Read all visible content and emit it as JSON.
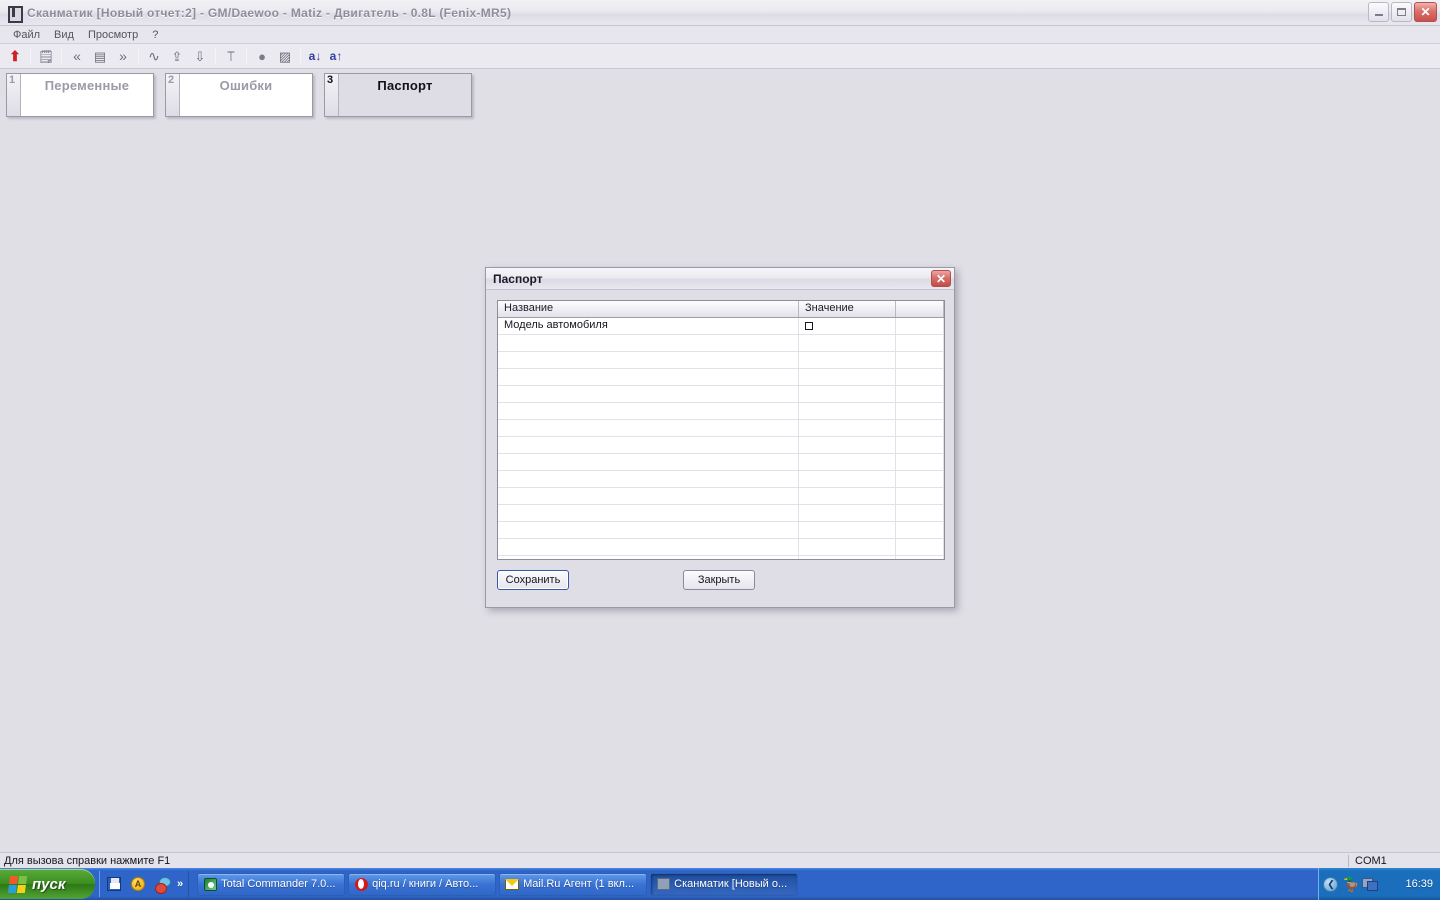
{
  "window": {
    "title": "Сканматик [Новый отчет:2] - GM/Daewoo - Matiz - Двигатель - 0.8L (Fenix-MR5)",
    "app_icon": "scanner-icon",
    "controls": {
      "minimize": "minimize-icon",
      "maximize": "restore-icon",
      "close": "✕"
    }
  },
  "menubar": {
    "items": [
      {
        "label": "Файл"
      },
      {
        "label": "Вид"
      },
      {
        "label": "Просмотр"
      },
      {
        "label": "?"
      }
    ]
  },
  "toolbar": {
    "buttons": [
      {
        "name": "upload-arrow-icon",
        "glyph": "⬆",
        "accent": "#cc2222"
      },
      {
        "name": "edit-report-icon",
        "glyph": "🗒"
      },
      {
        "name": "prev-page-icon",
        "glyph": "«"
      },
      {
        "name": "list-view-icon",
        "glyph": "▤"
      },
      {
        "name": "next-page-icon",
        "glyph": "»"
      },
      {
        "name": "waveform-icon",
        "glyph": "∿"
      },
      {
        "name": "add-channel-icon",
        "glyph": "⇪"
      },
      {
        "name": "remove-channel-icon",
        "glyph": "⇩"
      },
      {
        "name": "trigger-icon",
        "glyph": "⟙"
      },
      {
        "name": "record-icon",
        "glyph": "●"
      },
      {
        "name": "snapshot-icon",
        "glyph": "▨"
      },
      {
        "name": "font-decrease-icon",
        "glyph": "a↓"
      },
      {
        "name": "font-increase-icon",
        "glyph": "a↑"
      }
    ]
  },
  "tabs": [
    {
      "num": "1",
      "label": "Переменные",
      "active": false
    },
    {
      "num": "2",
      "label": "Ошибки",
      "active": false
    },
    {
      "num": "3",
      "label": "Паспорт",
      "active": true
    }
  ],
  "dialog": {
    "title": "Паспорт",
    "close_glyph": "✕",
    "grid": {
      "columns": [
        "Название",
        "Значение",
        ""
      ],
      "rows": [
        {
          "name": "Модель автомобиля",
          "value_glyph": "box",
          "extra": ""
        },
        {
          "name": "",
          "value_glyph": "",
          "extra": ""
        },
        {
          "name": "",
          "value_glyph": "",
          "extra": ""
        },
        {
          "name": "",
          "value_glyph": "",
          "extra": ""
        },
        {
          "name": "",
          "value_glyph": "",
          "extra": ""
        },
        {
          "name": "",
          "value_glyph": "",
          "extra": ""
        },
        {
          "name": "",
          "value_glyph": "",
          "extra": ""
        },
        {
          "name": "",
          "value_glyph": "",
          "extra": ""
        },
        {
          "name": "",
          "value_glyph": "",
          "extra": ""
        },
        {
          "name": "",
          "value_glyph": "",
          "extra": ""
        },
        {
          "name": "",
          "value_glyph": "",
          "extra": ""
        },
        {
          "name": "",
          "value_glyph": "",
          "extra": ""
        },
        {
          "name": "",
          "value_glyph": "",
          "extra": ""
        },
        {
          "name": "",
          "value_glyph": "",
          "extra": ""
        },
        {
          "name": "",
          "value_glyph": "",
          "extra": ""
        }
      ]
    },
    "save_label": "Сохранить",
    "close_label": "Закрыть"
  },
  "statusbar": {
    "hint": "Для вызова справки нажмите F1",
    "port": "COM1"
  },
  "taskbar": {
    "start_label": "пуск",
    "quicklaunch": [
      {
        "name": "floppy-save-icon"
      },
      {
        "name": "acrobat-icon",
        "glyph": "A"
      },
      {
        "name": "mixer-icon"
      }
    ],
    "quicklaunch_more": "»",
    "tasks": [
      {
        "label": "Total Commander 7.0...",
        "icon": "total-commander-icon",
        "active": false
      },
      {
        "label": "qiq.ru / книги / Авто...",
        "icon": "opera-icon",
        "active": false
      },
      {
        "label": "Mail.Ru Агент (1 вкл...",
        "icon": "mail-envelope-icon",
        "active": false
      },
      {
        "label": "Сканматик [Новый о...",
        "icon": "scanmatik-icon",
        "active": true
      }
    ],
    "tray": {
      "collapse_glyph": "❮",
      "icons": [
        {
          "name": "duck-icon",
          "glyph": "🦆"
        },
        {
          "name": "network-icon"
        },
        {
          "name": "pencil-icon"
        }
      ],
      "time": "16:39"
    }
  },
  "colors": {
    "desktop": "#e0dfe6",
    "taskbar_blue": "#2f64c8",
    "start_green": "#3c8f20",
    "close_red": "#c9504c",
    "toolbar_accent": "#2f3d9c"
  }
}
